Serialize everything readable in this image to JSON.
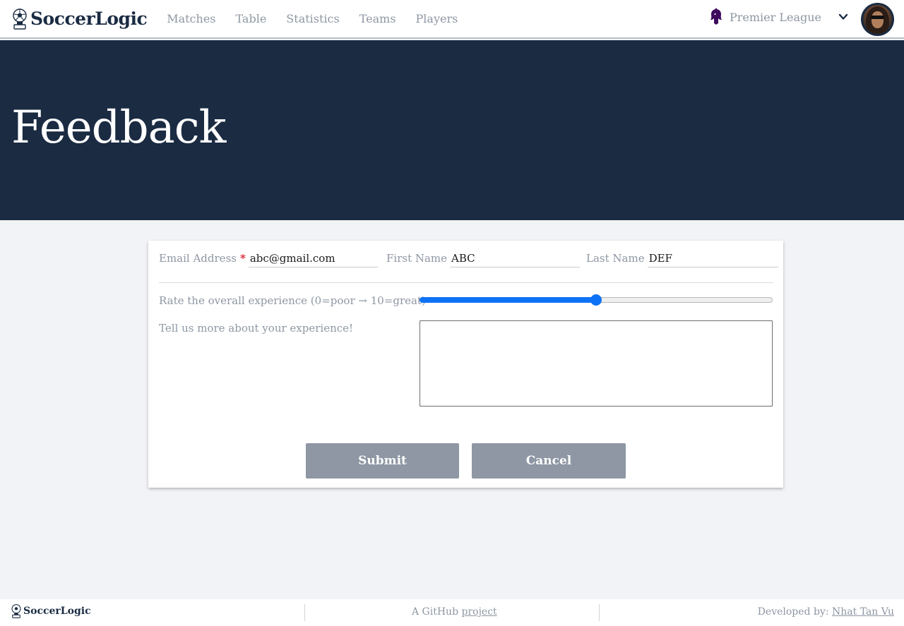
{
  "brand": {
    "name": "SoccerLogic",
    "icon": "trophy-icon"
  },
  "nav": {
    "links": [
      "Matches",
      "Table",
      "Statistics",
      "Teams",
      "Players"
    ],
    "league": "Premier League",
    "league_icon": "premier-league-lion-icon",
    "dropdown_icon": "chevron-down-icon"
  },
  "hero": {
    "title": "Feedback"
  },
  "form": {
    "email": {
      "label": "Email Address",
      "required_mark": "*",
      "value": "abc@gmail.com"
    },
    "first_name": {
      "label": "First Name",
      "value": "ABC"
    },
    "last_name": {
      "label": "Last Name",
      "value": "DEF"
    },
    "rating": {
      "label": "Rate the overall experience (0=poor → 10=great)",
      "min": 0,
      "max": 10,
      "value": 5
    },
    "comments": {
      "label": "Tell us more about your experience!",
      "value": ""
    },
    "submit_label": "Submit",
    "cancel_label": "Cancel"
  },
  "footer": {
    "brand": "SoccerLogic",
    "github_prefix": "A GitHub",
    "github_link": "project",
    "developer_prefix": "Developed by:",
    "developer_name": "Nhat Tan Vu"
  },
  "colors": {
    "navy": "#1a2b42",
    "muted": "#8e97a3",
    "accent": "#0d72f5",
    "required": "#d9212c",
    "background": "#f2f3f6"
  }
}
